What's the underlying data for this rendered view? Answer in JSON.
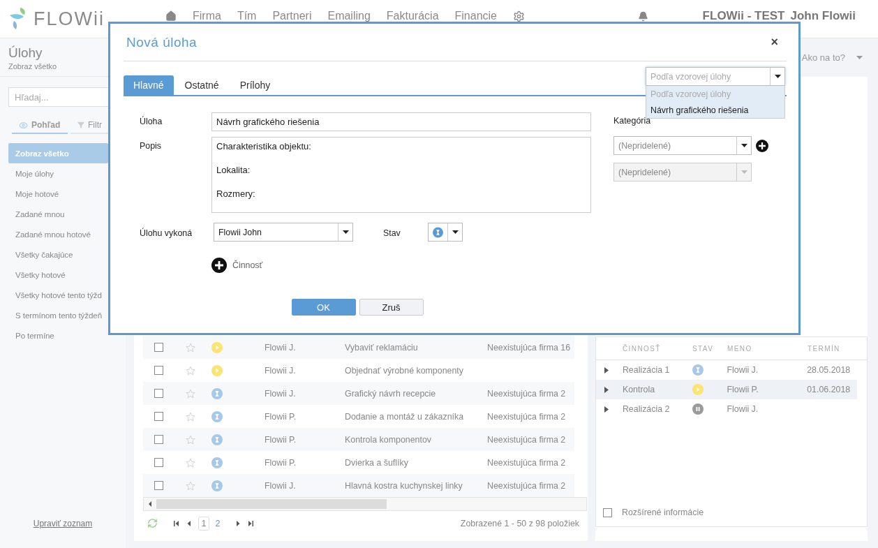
{
  "app": {
    "logo": "FLOWii",
    "nav": [
      {
        "label": "Firma"
      },
      {
        "label": "Tím"
      },
      {
        "label": "Partneri"
      },
      {
        "label": "Emailing"
      },
      {
        "label": "Fakturácia"
      },
      {
        "label": "Financie"
      }
    ],
    "company": "FLOWii - TEST",
    "user": "John Flowii"
  },
  "sidebar": {
    "title": "Úlohy",
    "subtitle": "Zobraz všetko",
    "search": {
      "placeholder": "Hľadaj..."
    },
    "view_tabs": [
      {
        "label": "Pohľad",
        "selected": true
      },
      {
        "label": "Filtr",
        "selected": false
      }
    ],
    "items": [
      {
        "label": "Zobraz všetko",
        "selected": true
      },
      {
        "label": "Moje úlohy",
        "selected": false
      },
      {
        "label": "Moje hotové",
        "selected": false
      },
      {
        "label": "Zadané mnou",
        "selected": false
      },
      {
        "label": "Zadané mnou hotové",
        "selected": false
      },
      {
        "label": "Všetky čakajúce",
        "selected": false
      },
      {
        "label": "Všetky hotové",
        "selected": false
      },
      {
        "label": "Všetky hotové tento týžd",
        "selected": false
      },
      {
        "label": "S termínom tento týždeň",
        "selected": false
      },
      {
        "label": "Po termíne",
        "selected": false
      }
    ],
    "edit_link": "Upraviť zoznam"
  },
  "help": "Ako na to?",
  "tasks": {
    "rows": [
      {
        "checked": false,
        "starred": false,
        "kind": "running",
        "owner": "Flowii J.",
        "task": "Vybaviť reklamáciu",
        "company": "Neexistujúca firma 16"
      },
      {
        "checked": false,
        "starred": false,
        "kind": "running",
        "owner": "Flowii J.",
        "task": "Objednať výrobné komponenty"
      },
      {
        "checked": false,
        "starred": false,
        "kind": "waiting",
        "owner": "Flowii J.",
        "task": "Grafický návrh recepcie",
        "company": "Neexistujúca firma 2"
      },
      {
        "checked": false,
        "starred": false,
        "kind": "waiting",
        "owner": "Flowii P.",
        "task": "Dodanie a montáž u zákazníka",
        "company": "Neexistujúca firma 2"
      },
      {
        "checked": false,
        "starred": false,
        "kind": "waiting",
        "owner": "Flowii P.",
        "task": "Kontrola komponentov",
        "company": "Neexistujúca firma 2"
      },
      {
        "checked": false,
        "starred": false,
        "kind": "waiting",
        "owner": "Flowii P.",
        "task": "Dvierka a šuflíky",
        "company": "Neexistujúca firma 2"
      },
      {
        "checked": false,
        "starred": false,
        "kind": "waiting",
        "owner": "Flowii J.",
        "task": "Hlavná kostra kuchynskej linky",
        "company": "Neexistujúca firma 2"
      }
    ],
    "pages": [
      {
        "label": "1",
        "selected": true
      },
      {
        "label": "2",
        "selected": false
      }
    ],
    "summary": "Zobrazené 1 - 50 z 98 položiek"
  },
  "activities": {
    "columns": [
      "ČINNOSŤ",
      "STAV",
      "MENO",
      "TERMÍN"
    ],
    "rows": [
      {
        "name": "Realizácia 1",
        "kind": "waiting",
        "person": "Flowii J.",
        "date": "28.05.2018",
        "selected": false
      },
      {
        "name": "Kontrola",
        "kind": "running",
        "person": "Flowii P.",
        "date": "01.06.2018",
        "selected": true
      },
      {
        "name": "Realizácia 2",
        "kind": "paused",
        "person": "Flowii J.",
        "selected": false
      }
    ],
    "extended": {
      "label": "Rozšírené informácie",
      "checked": false
    }
  },
  "dialog": {
    "title": "Nová úloha",
    "close": "×",
    "tabs": [
      {
        "label": "Hlavné",
        "selected": true
      },
      {
        "label": "Ostatné",
        "selected": false
      },
      {
        "label": "Prílohy",
        "selected": false
      }
    ],
    "template": {
      "placeholder": "Podľa vzorovej úlohy",
      "options": [
        {
          "label": "Podľa vzorovej úlohy",
          "disabled": true
        },
        {
          "label": "Návrh grafického riešenia",
          "disabled": false
        }
      ]
    },
    "task": {
      "label": "Úloha",
      "value": "Návrh grafického riešenia"
    },
    "description": {
      "label": "Popis",
      "value": "Charakteristika objektu:\n\nLokalita:\n\nRozmery:"
    },
    "category": {
      "label": "Kategória",
      "selects": [
        {
          "value": "(Nepridelené)",
          "disabled": false
        },
        {
          "value": "(Nepridelené)",
          "disabled": true
        }
      ]
    },
    "assignee": {
      "label": "Úlohu vykoná",
      "value": "Flowii John"
    },
    "state": {
      "label": "Stav",
      "kind": "waiting"
    },
    "add_activity": "Činnosť",
    "buttons": [
      {
        "label": "OK",
        "kind": "primary"
      },
      {
        "label": "Zruš",
        "kind": "secondary"
      }
    ]
  }
}
